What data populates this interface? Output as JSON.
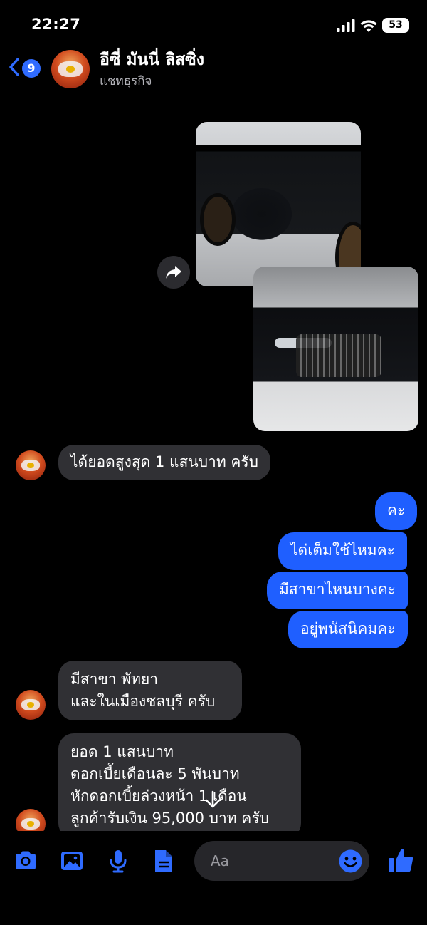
{
  "status": {
    "time": "22:27",
    "battery": "53"
  },
  "header": {
    "unread_count": "9",
    "name": "อีซี่ มันนี่ ลิสซิ่ง",
    "subtitle": "แชทธุรกิจ"
  },
  "messages": [
    {
      "side": "in",
      "text": "ได้ยอดสูงสุด 1 แสนบาท ครับ"
    },
    {
      "side": "out",
      "text": "คะ"
    },
    {
      "side": "out",
      "text": "ได่เต็มใช้ไหมคะ"
    },
    {
      "side": "out",
      "text": "มีสาขาไหนบางคะ"
    },
    {
      "side": "out",
      "text": "อยู่พนัสนิคมคะ"
    },
    {
      "side": "in",
      "text": "มีสาขา พัทยา\nและในเมืองชลบุรี ครับ"
    },
    {
      "side": "in",
      "text": "ยอด 1 แสนบาท\nดอกเบี้ยเดือนละ 5 พันบาท\nหักดอกเบี้ยล่วงหน้า 1 เดือน\nลูกค้ารับเงิน 95,000 บาท ครับ"
    }
  ],
  "composer": {
    "placeholder": "Aa"
  },
  "colors": {
    "outgoing_bubble": "#1f5fff",
    "incoming_bubble": "#303034",
    "accent": "#2f6bff"
  },
  "icons": [
    "signal-icon",
    "wifi-icon",
    "battery-icon",
    "back-chevron-icon",
    "share-icon",
    "scroll-down-icon",
    "camera-icon",
    "gallery-icon",
    "microphone-icon",
    "file-icon",
    "emoji-icon",
    "like-icon"
  ]
}
